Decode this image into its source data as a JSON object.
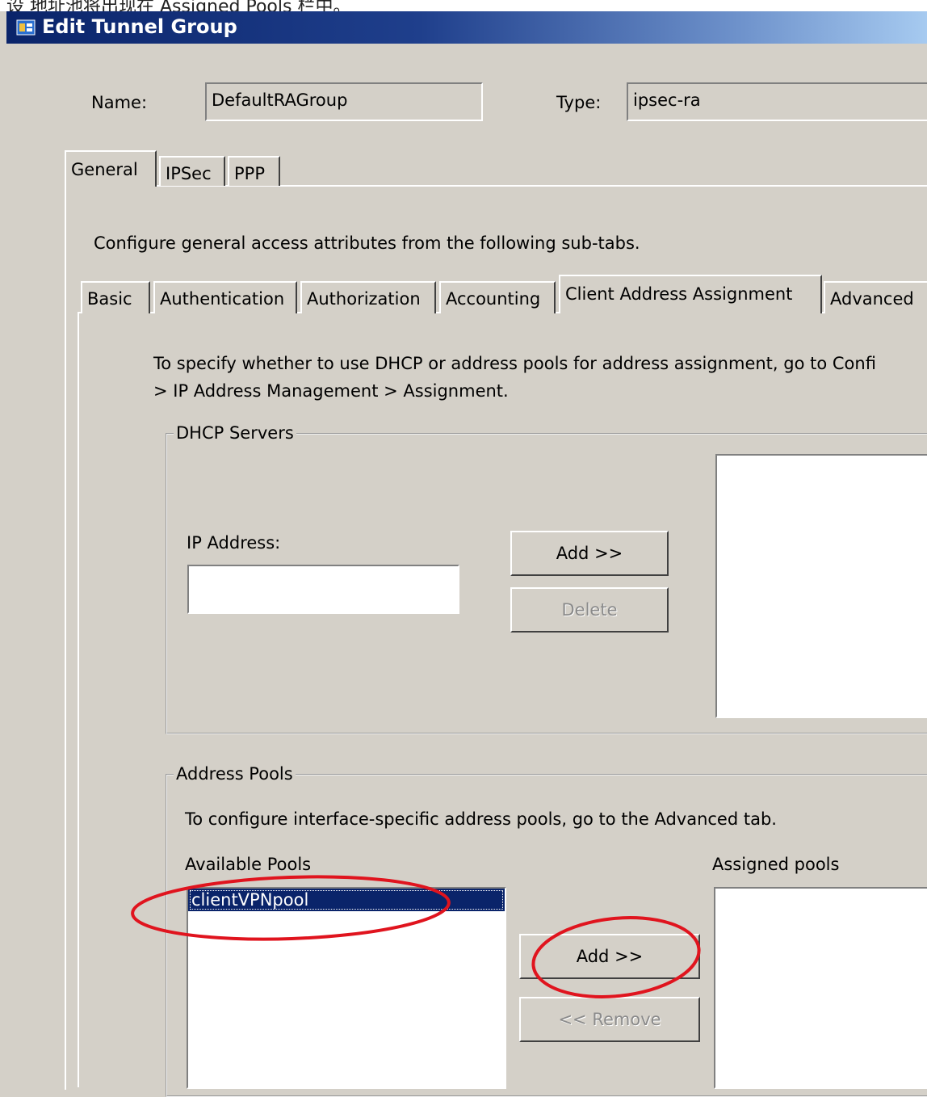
{
  "top_caption": "设 地址池将出现在 Assigned Pools 栏中。",
  "window": {
    "title": "Edit Tunnel Group"
  },
  "header": {
    "name_label": "Name:",
    "name_value": "DefaultRAGroup",
    "type_label": "Type:",
    "type_value": "ipsec-ra"
  },
  "main_tabs": [
    {
      "label": "General",
      "active": true
    },
    {
      "label": "IPSec",
      "active": false
    },
    {
      "label": "PPP",
      "active": false
    }
  ],
  "general_description": "Configure general access attributes from the following sub-tabs.",
  "sub_tabs": [
    {
      "label": "Basic",
      "active": false
    },
    {
      "label": "Authentication",
      "active": false
    },
    {
      "label": "Authorization",
      "active": false
    },
    {
      "label": "Accounting",
      "active": false
    },
    {
      "label": "Client Address Assignment",
      "active": true
    },
    {
      "label": "Advanced",
      "active": false
    }
  ],
  "instructions": {
    "line1": "To specify whether to use DHCP or address pools for address assignment, go to Confi",
    "line2": "> IP Address Management > Assignment."
  },
  "dhcp": {
    "legend": "DHCP Servers",
    "ip_label": "IP Address:",
    "ip_value": "",
    "add_button": "Add >>",
    "delete_button": "Delete"
  },
  "pools": {
    "legend": "Address Pools",
    "description": "To configure interface-specific address pools, go to the Advanced tab.",
    "available_label": "Available Pools",
    "assigned_label": "Assigned pools",
    "available_items": [
      "clientVPNpool"
    ],
    "assigned_items": [],
    "add_button": "Add >>",
    "remove_button": "<< Remove"
  },
  "annotation_color": "#e0141e"
}
